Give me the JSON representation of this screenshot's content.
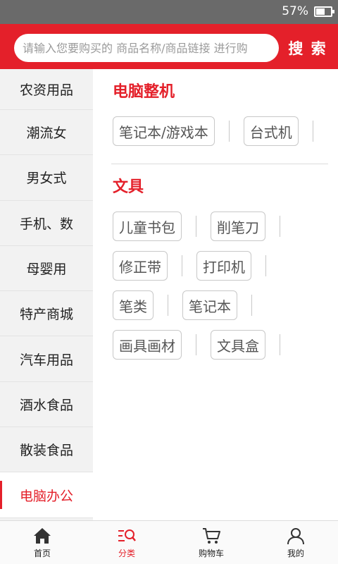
{
  "status_bar": {
    "battery": "57%"
  },
  "search": {
    "placeholder": "请输入您要购买的 商品名称/商品链接 进行购",
    "button_label": "搜 索"
  },
  "sidebar": {
    "items": [
      {
        "label": "农资用品"
      },
      {
        "label": "潮流女"
      },
      {
        "label": "男女式"
      },
      {
        "label": "手机、数"
      },
      {
        "label": "母婴用"
      },
      {
        "label": "特产商城"
      },
      {
        "label": "汽车用品"
      },
      {
        "label": "酒水食品"
      },
      {
        "label": "散装食品"
      },
      {
        "label": "电脑办公",
        "active": true
      }
    ]
  },
  "content": {
    "sections": [
      {
        "title": "电脑整机",
        "rows": [
          [
            "笔记本/游戏本",
            "台式机"
          ]
        ]
      },
      {
        "title": "文具",
        "rows": [
          [
            "儿童书包",
            "削笔刀"
          ],
          [
            "修正带",
            "打印机"
          ],
          [
            "笔类",
            "笔记本"
          ],
          [
            "画具画材",
            "文具盒"
          ]
        ]
      }
    ]
  },
  "bottom_nav": {
    "items": [
      {
        "label": "首页",
        "icon": "home-icon"
      },
      {
        "label": "分类",
        "icon": "category-search-icon",
        "active": true
      },
      {
        "label": "购物车",
        "icon": "cart-icon"
      },
      {
        "label": "我的",
        "icon": "user-icon"
      }
    ]
  },
  "colors": {
    "accent": "#e4202a",
    "sidebar_bg": "#f2f2f2"
  }
}
